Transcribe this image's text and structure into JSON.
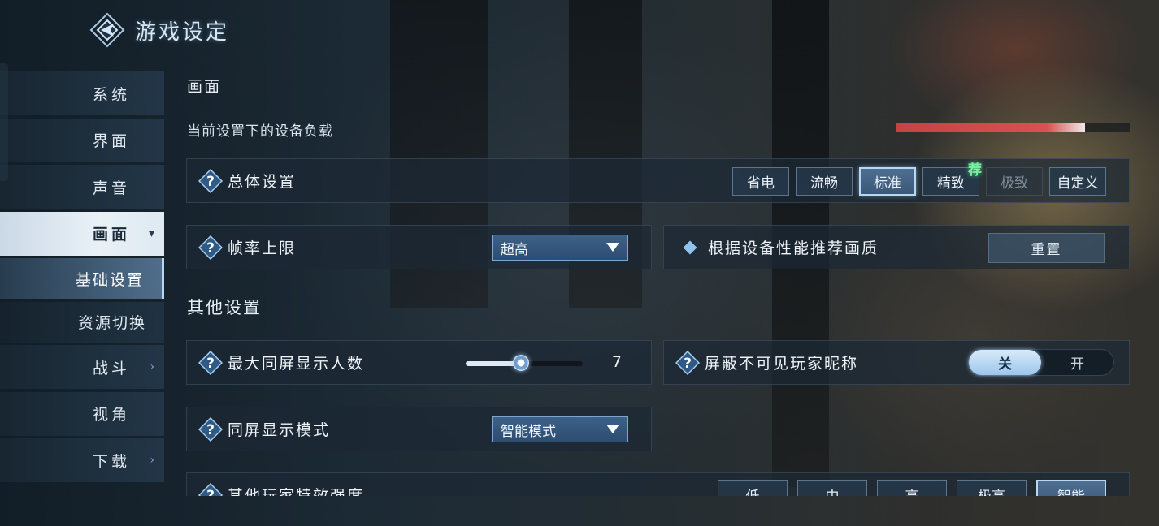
{
  "header": {
    "title": "游戏设定",
    "logo_icon": "diamond-emblem-icon"
  },
  "sidebar": {
    "items": [
      {
        "label": "系统",
        "has_arrow": false
      },
      {
        "label": "界面",
        "has_arrow": false
      },
      {
        "label": "声音",
        "has_arrow": false
      },
      {
        "label": "画面",
        "has_arrow": true,
        "active": true,
        "arrow": "▾"
      },
      {
        "label": "基础设置",
        "sub": true,
        "active": true
      },
      {
        "label": "资源切换",
        "sub": true
      },
      {
        "label": "战斗",
        "has_arrow": true,
        "arrow": "›"
      },
      {
        "label": "视角",
        "has_arrow": false
      },
      {
        "label": "下载",
        "has_arrow": true,
        "arrow": "›"
      }
    ]
  },
  "main": {
    "section_picture": "画面",
    "device_load": {
      "label": "当前设置下的设备负载",
      "value": 0.81,
      "color": "#c94848"
    },
    "overall": {
      "label": "总体设置",
      "options": [
        "省电",
        "流畅",
        "标准",
        "精致",
        "极致",
        "自定义"
      ],
      "selected": "标准",
      "disabled": [
        "极致"
      ],
      "recommended_badge": "荐",
      "recommended_option": "精致"
    },
    "fps": {
      "label": "帧率上限",
      "value": "超高"
    },
    "recommend_quality": {
      "label": "根据设备性能推荐画质",
      "button": "重置"
    },
    "section_other": "其他设置",
    "max_players": {
      "label": "最大同屏显示人数",
      "value": "7",
      "level": 0.47
    },
    "hide_names": {
      "label": "屏蔽不可见玩家昵称",
      "off_label": "关",
      "on_label": "开",
      "state": "关"
    },
    "display_mode": {
      "label": "同屏显示模式",
      "value": "智能模式"
    },
    "effects": {
      "label": "其他玩家特效强度",
      "options": [
        "低",
        "中",
        "高",
        "极高",
        "智能"
      ],
      "selected": "智能"
    }
  },
  "colors": {
    "accent": "#b9d6f2",
    "panel": "#1c2834",
    "recommend": "#78f0a0"
  }
}
